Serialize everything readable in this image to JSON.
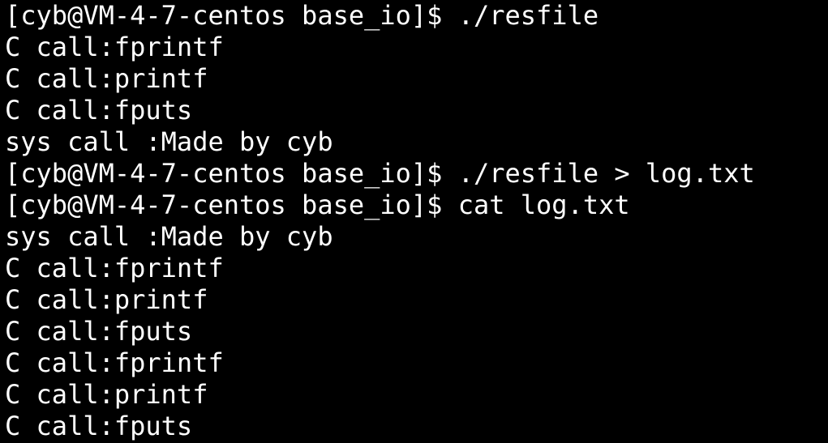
{
  "terminal": {
    "lines": [
      "[cyb@VM-4-7-centos base_io]$ ./resfile",
      "C call:fprintf",
      "C call:printf",
      "C call:fputs",
      "sys call :Made by cyb",
      "[cyb@VM-4-7-centos base_io]$ ./resfile > log.txt",
      "[cyb@VM-4-7-centos base_io]$ cat log.txt",
      "sys call :Made by cyb",
      "C call:fprintf",
      "C call:printf",
      "C call:fputs",
      "C call:fprintf",
      "C call:printf",
      "C call:fputs"
    ]
  }
}
